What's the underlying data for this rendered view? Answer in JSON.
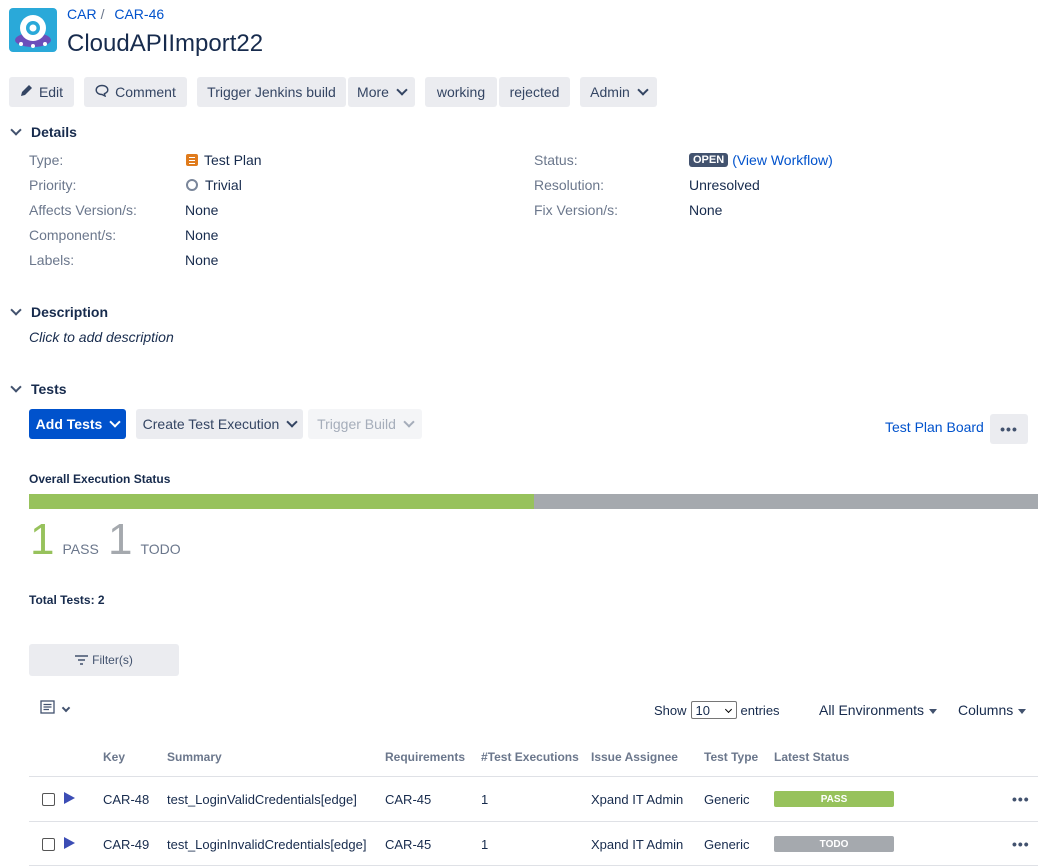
{
  "breadcrumb": {
    "project": "CAR",
    "parent": "CAR-46"
  },
  "issue": {
    "title": "CloudAPIImport22"
  },
  "toolbar": {
    "edit": "Edit",
    "comment": "Comment",
    "trigger_jenkins": "Trigger Jenkins build",
    "more": "More",
    "working": "working",
    "rejected": "rejected",
    "admin": "Admin"
  },
  "details": {
    "heading": "Details",
    "type_label": "Type:",
    "type_value": "Test Plan",
    "priority_label": "Priority:",
    "priority_value": "Trivial",
    "affects_label": "Affects Version/s:",
    "affects_value": "None",
    "component_label": "Component/s:",
    "component_value": "None",
    "labels_label": "Labels:",
    "labels_value": "None",
    "status_label": "Status:",
    "status_value": "OPEN",
    "status_link": "(View Workflow)",
    "resolution_label": "Resolution:",
    "resolution_value": "Unresolved",
    "fix_label": "Fix Version/s:",
    "fix_value": "None"
  },
  "description": {
    "heading": "Description",
    "placeholder": "Click to add description"
  },
  "tests": {
    "heading": "Tests",
    "add_tests": "Add Tests",
    "create_execution": "Create Test Execution",
    "trigger_build": "Trigger Build",
    "board_link": "Test Plan Board",
    "more": "•••",
    "overall_label": "Overall Execution Status",
    "progress": {
      "pass_fraction": 0.5,
      "todo_fraction": 0.5
    },
    "pass_count": "1",
    "pass_label": "PASS",
    "todo_count": "1",
    "todo_label": "TODO",
    "total": "Total Tests: 2",
    "filter": "Filter(s)",
    "show_label": "Show",
    "entries_value": "10",
    "entries_label": "entries",
    "env_dropdown": "All Environments",
    "columns_dropdown": "Columns",
    "columns": [
      "Key",
      "Summary",
      "Requirements",
      "#Test Executions",
      "Issue Assignee",
      "Test Type",
      "Latest Status"
    ],
    "rows": [
      {
        "key": "CAR-48",
        "summary": "test_LoginValidCredentials[edge]",
        "requirements": "CAR-45",
        "executions": "1",
        "assignee": "Xpand IT Admin",
        "type": "Generic",
        "status": "PASS",
        "status_color": "#97c25c"
      },
      {
        "key": "CAR-49",
        "summary": "test_LoginInvalidCredentials[edge]",
        "requirements": "CAR-45",
        "executions": "1",
        "assignee": "Xpand IT Admin",
        "type": "Generic",
        "status": "TODO",
        "status_color": "#a5a9ae"
      }
    ],
    "row_more": "•••"
  },
  "colors": {
    "primary": "#0052cc",
    "pass": "#97c25c",
    "todo": "#a5a9ae",
    "status_open": "#42526e"
  },
  "icons": {
    "edit": "pencil-icon",
    "comment": "comment-icon",
    "filter": "filter-icon",
    "columns": "column-config-icon",
    "test": "play-icon"
  }
}
